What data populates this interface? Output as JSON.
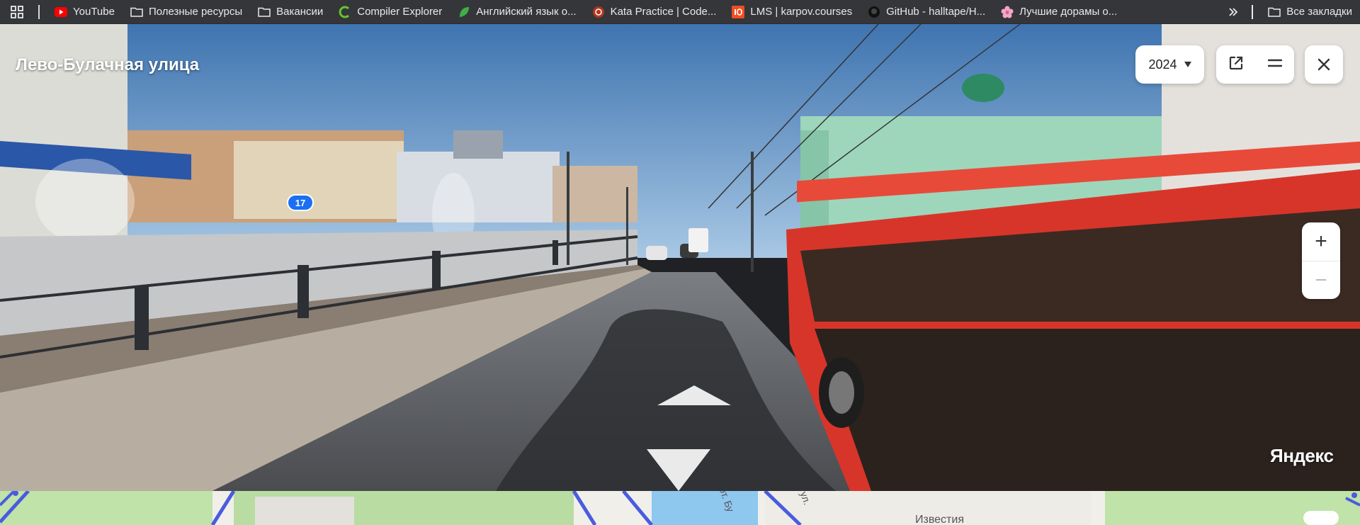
{
  "bookmarks": [
    {
      "label": "YouTube",
      "icon": "youtube-icon"
    },
    {
      "label": "Полезные ресурсы",
      "icon": "folder-icon"
    },
    {
      "label": "Вакансии",
      "icon": "folder-icon"
    },
    {
      "label": "Compiler Explorer",
      "icon": "compiler-explorer-icon"
    },
    {
      "label": "Английский язык о...",
      "icon": "leaf-icon"
    },
    {
      "label": "Kata Practice | Code...",
      "icon": "codewars-icon"
    },
    {
      "label": "LMS | karpov.courses",
      "icon": "karpov-icon"
    },
    {
      "label": "GitHub - halltape/H...",
      "icon": "github-icon"
    },
    {
      "label": "Лучшие дорамы о...",
      "icon": "flower-icon"
    }
  ],
  "all_bookmarks_label": "Все закладки",
  "panorama": {
    "street_name": "Лево-Булачная улица",
    "year": "2024",
    "zoom_in": "+",
    "zoom_out": "−",
    "marker_number": "17",
    "brand": "Яндекс"
  },
  "map": {
    "labels": [
      "Известия",
      "ул.",
      "от. Бу"
    ]
  },
  "colors": {
    "bookmarks_bg": "#35363a",
    "bus_red": "#d8352a",
    "marker_blue": "#1a6ff2"
  }
}
